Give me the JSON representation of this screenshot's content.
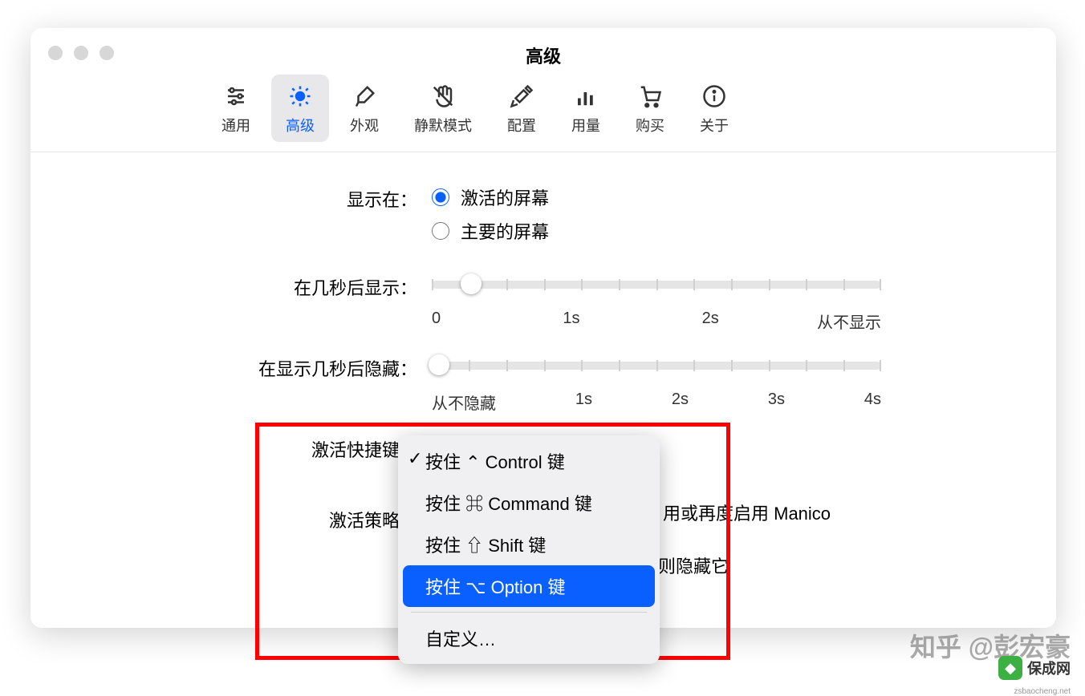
{
  "window": {
    "title": "高级"
  },
  "tabs": [
    {
      "label": "通用"
    },
    {
      "label": "高级"
    },
    {
      "label": "外观"
    },
    {
      "label": "静默模式"
    },
    {
      "label": "配置"
    },
    {
      "label": "用量"
    },
    {
      "label": "购买"
    },
    {
      "label": "关于"
    }
  ],
  "form": {
    "showOn": {
      "label": "显示在：",
      "opt1": "激活的屏幕",
      "opt2": "主要的屏幕"
    },
    "showAfter": {
      "label": "在几秒后显示：",
      "scale": [
        "0",
        "1s",
        "2s",
        "从不显示"
      ]
    },
    "hideAfter": {
      "label": "在显示几秒后隐藏：",
      "scale": [
        "从不隐藏",
        "1s",
        "2s",
        "3s",
        "4s"
      ]
    },
    "hotkey": {
      "label": "激活快捷键："
    },
    "policy": {
      "label": "激活策略："
    },
    "bg1": "用或再度启用 Manico",
    "bg2": "则隐藏它"
  },
  "dropdown": {
    "items": [
      "按住 ⌃ Control 键",
      "按住 ⌘ Command 键",
      "按住 ⇧ Shift 键",
      "按住 ⌥ Option 键"
    ],
    "custom": "自定义…"
  },
  "watermark": "知乎 @彭宏豪",
  "badge": {
    "name": "保成网",
    "url": "zsbaocheng.net"
  }
}
